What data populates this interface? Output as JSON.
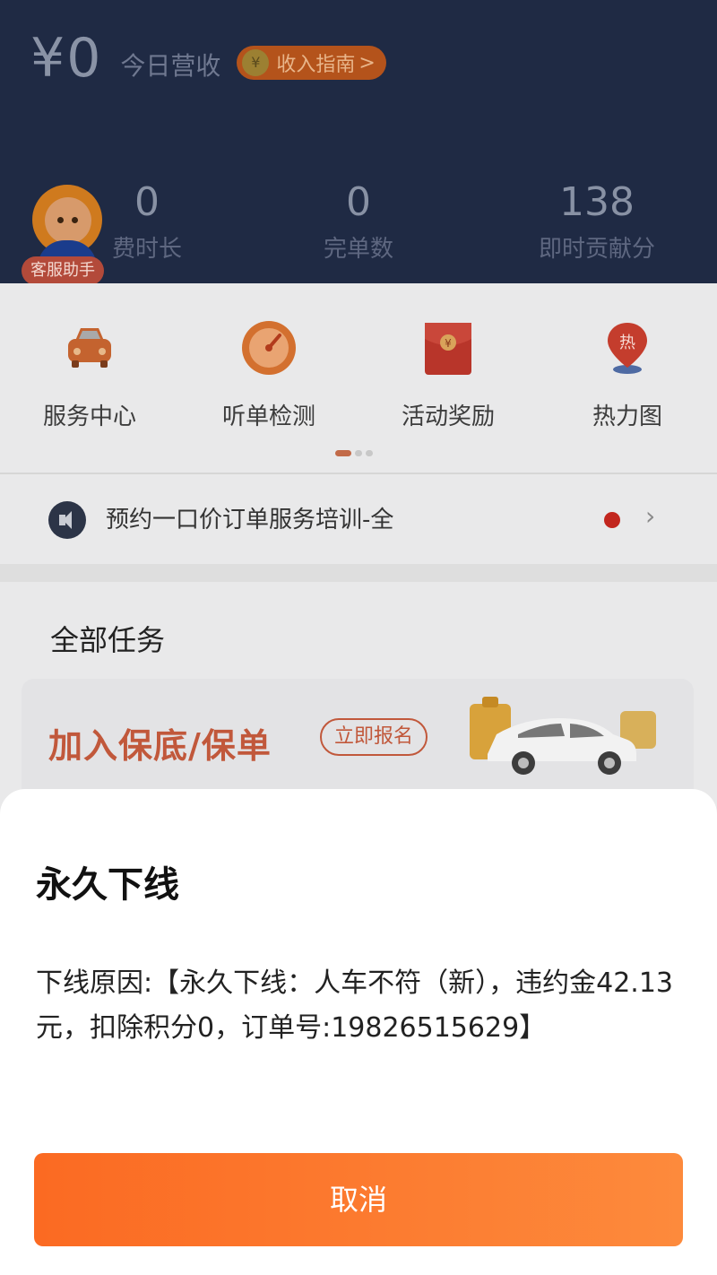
{
  "header": {
    "currency_symbol": "¥",
    "revenue_amount": "0",
    "revenue_label": "今日营收",
    "guide_coin": "¥",
    "guide_label": "收入指南",
    "guide_arrow": ">",
    "stats": [
      {
        "value": "0",
        "label": "费时长"
      },
      {
        "value": "0",
        "label": "完单数"
      },
      {
        "value": "138",
        "label": "即时贡献分"
      }
    ]
  },
  "assistant": {
    "label": "客服助手"
  },
  "quick_menu": {
    "items": [
      {
        "label": "服务中心",
        "icon": "car-icon"
      },
      {
        "label": "听单检测",
        "icon": "gauge-icon"
      },
      {
        "label": "活动奖励",
        "icon": "red-envelope-icon"
      },
      {
        "label": "热力图",
        "icon": "heatmap-pin-icon",
        "badge": "热"
      }
    ],
    "page_indicator": {
      "pages": 3,
      "active": 1
    }
  },
  "notice": {
    "text": "预约一口价订单服务培训-全",
    "chevron": "›"
  },
  "tasks": {
    "title": "全部任务",
    "banner_title": "加入保底/保单",
    "banner_button": "立即报名"
  },
  "dialog": {
    "title": "永久下线",
    "message": "下线原因:【永久下线：人车不符（新），违约金42.13元，扣除积分0，订单号:19826515629】",
    "cancel_label": "取消"
  },
  "colors": {
    "header_bg": "#1f2a44",
    "accent_orange": "#fb6a22",
    "banner_text": "#c1583b"
  }
}
